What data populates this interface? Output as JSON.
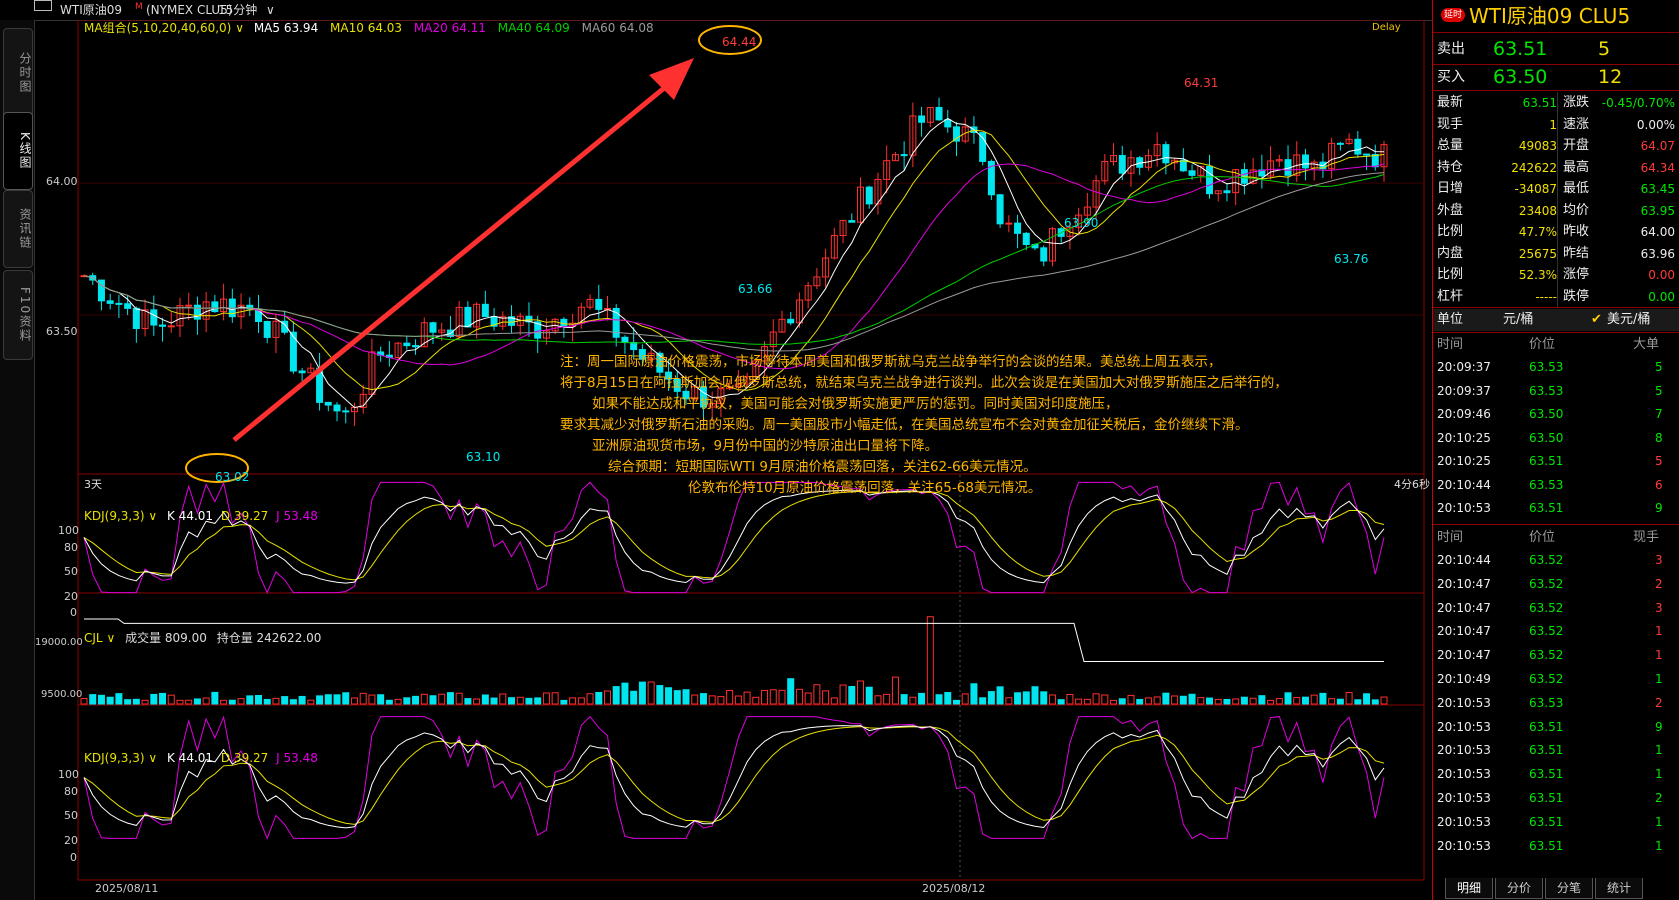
{
  "topbar": {
    "icon": "window-icon",
    "symbol": "WTI原油09",
    "symbol_mark": "M",
    "exchange": "(NYMEX CLU5)",
    "period": "15分钟",
    "period_arrow": "∨"
  },
  "left_tabs": [
    "分时图",
    "K线图",
    "资讯链",
    "F10资料"
  ],
  "chart_data": [
    {
      "type": "candlestick",
      "indicator_label": "MA组合(5,10,20,40,60,0)",
      "ma_items": [
        {
          "label": "MA5",
          "value": "63.94",
          "color": "#ffffff"
        },
        {
          "label": "MA10",
          "value": "64.03",
          "color": "#e8e000"
        },
        {
          "label": "MA20",
          "value": "64.11",
          "color": "#e000e0"
        },
        {
          "label": "MA40",
          "value": "64.09",
          "color": "#00d000"
        },
        {
          "label": "MA60",
          "value": "64.08",
          "color": "#9a9a9a"
        }
      ],
      "delay_tag": "Delay",
      "y_ticks": [
        "64.00",
        "63.50"
      ],
      "price_annotations": [
        "64.44",
        "64.31",
        "63.90",
        "63.76",
        "63.66",
        "63.10",
        "63.02"
      ],
      "bottom_left": "3天",
      "bottom_right": "4分6秒",
      "ylim": [
        62.95,
        64.55
      ]
    },
    {
      "type": "line",
      "indicator_label": "KDJ(9,3,3)",
      "values_text": {
        "K": "K 44.01",
        "D": "D 39.27",
        "J": "J 53.48"
      },
      "y_ticks": [
        "100",
        "80",
        "50",
        "20",
        "0"
      ]
    },
    {
      "type": "bar",
      "indicator_label": "CJL",
      "volume_text": "成交量 809.00",
      "oi_text": "持仓量 242622.00",
      "y_ticks": [
        "19000.00",
        "9500.00"
      ]
    },
    {
      "type": "line",
      "indicator_label": "KDJ(9,3,3)",
      "values_text": {
        "K": "K 44.01",
        "D": "D 39.27",
        "J": "J 53.48"
      },
      "y_ticks": [
        "100",
        "80",
        "50",
        "20",
        "0"
      ]
    }
  ],
  "x_dates": [
    "2025/08/11",
    "2025/08/12"
  ],
  "annotation": {
    "lines": [
      "注：周一国际原油价格震荡，市场等待本周美国和俄罗斯就乌克兰战争举行的会谈的结果。美总统上周五表示，",
      "将于8月15日在阿拉斯加会见俄罗斯总统，就结束乌克兰战争进行谈判。此次会谈是在美国加大对俄罗斯施压之后举行的，",
      "如果不能达成和平协议，美国可能会对俄罗斯实施更严厉的惩罚。同时美国对印度施压，",
      "要求其减少对俄罗斯石油的采购。周一美国股市小幅走低，在美国总统宣布不会对黄金加征关税后，金价继续下滑。",
      "亚洲原油现货市场，9月份中国的沙特原油出口量将下降。",
      "综合预期：短期国际WTI 9月原油价格震荡回落，关注62-66美元情况。",
      "伦敦布伦特10月原油价格震荡回落，关注65-68美元情况。"
    ]
  },
  "quote": {
    "badge": "延时",
    "title": "WTI原油09 CLU5",
    "sell": {
      "label": "卖出",
      "price": "63.51",
      "qty": "5"
    },
    "buy": {
      "label": "买入",
      "price": "63.50",
      "qty": "12"
    },
    "stats": [
      {
        "l1": "最新",
        "v1": "63.51",
        "c1": "green",
        "l2": "涨跌",
        "v2": "-0.45/0.70%",
        "c2": "green"
      },
      {
        "l1": "现手",
        "v1": "1",
        "c1": "yellow",
        "l2": "速涨",
        "v2": "0.00%",
        "c2": "white"
      },
      {
        "l1": "总量",
        "v1": "49083",
        "c1": "yellow",
        "l2": "开盘",
        "v2": "64.07",
        "c2": "red"
      },
      {
        "l1": "持仓",
        "v1": "242622",
        "c1": "yellow",
        "l2": "最高",
        "v2": "64.34",
        "c2": "red"
      },
      {
        "l1": "日增",
        "v1": "-34087",
        "c1": "yellow",
        "l2": "最低",
        "v2": "63.45",
        "c2": "green"
      },
      {
        "l1": "外盘",
        "v1": "23408",
        "c1": "yellow",
        "l2": "均价",
        "v2": "63.95",
        "c2": "green"
      },
      {
        "l1": "比例",
        "v1": "47.7%",
        "c1": "yellow",
        "l2": "昨收",
        "v2": "64.00",
        "c2": "white"
      },
      {
        "l1": "内盘",
        "v1": "25675",
        "c1": "yellow",
        "l2": "昨结",
        "v2": "63.96",
        "c2": "white"
      },
      {
        "l1": "比例",
        "v1": "52.3%",
        "c1": "yellow",
        "l2": "涨停",
        "v2": "0.00",
        "c2": "red"
      },
      {
        "l1": "杠杆",
        "v1": "-----",
        "c1": "yellow",
        "l2": "跌停",
        "v2": "0.00",
        "c2": "green"
      }
    ],
    "unit": {
      "label": "单位",
      "opt1": "元/桶",
      "opt2": "美元/桶",
      "check": "✔"
    },
    "ticks_header": {
      "time": "时间",
      "price": "价位",
      "vol": "大单"
    },
    "ticks": [
      {
        "time": "20:09:37",
        "price": "63.53",
        "vol": "5",
        "vc": "green"
      },
      {
        "time": "20:09:37",
        "price": "63.53",
        "vol": "5",
        "vc": "green"
      },
      {
        "time": "20:09:46",
        "price": "63.50",
        "vol": "7",
        "vc": "green"
      },
      {
        "time": "20:10:25",
        "price": "63.50",
        "vol": "8",
        "vc": "green"
      },
      {
        "time": "20:10:25",
        "price": "63.51",
        "vol": "5",
        "vc": "red"
      },
      {
        "time": "20:10:44",
        "price": "63.53",
        "vol": "6",
        "vc": "red"
      },
      {
        "time": "20:10:53",
        "price": "63.51",
        "vol": "9",
        "vc": "green"
      }
    ],
    "trades_header": {
      "time": "时间",
      "price": "价位",
      "vol": "现手"
    },
    "trades": [
      {
        "time": "20:10:44",
        "price": "63.52",
        "vol": "3",
        "vc": "red"
      },
      {
        "time": "20:10:47",
        "price": "63.52",
        "vol": "2",
        "vc": "red"
      },
      {
        "time": "20:10:47",
        "price": "63.52",
        "vol": "3",
        "vc": "red"
      },
      {
        "time": "20:10:47",
        "price": "63.52",
        "vol": "1",
        "vc": "red"
      },
      {
        "time": "20:10:47",
        "price": "63.52",
        "vol": "1",
        "vc": "red"
      },
      {
        "time": "20:10:49",
        "price": "63.52",
        "vol": "1",
        "vc": "green"
      },
      {
        "time": "20:10:53",
        "price": "63.53",
        "vol": "2",
        "vc": "red"
      },
      {
        "time": "20:10:53",
        "price": "63.51",
        "vol": "9",
        "vc": "green"
      },
      {
        "time": "20:10:53",
        "price": "63.51",
        "vol": "1",
        "vc": "green"
      },
      {
        "time": "20:10:53",
        "price": "63.51",
        "vol": "1",
        "vc": "green"
      },
      {
        "time": "20:10:53",
        "price": "63.51",
        "vol": "2",
        "vc": "green"
      },
      {
        "time": "20:10:53",
        "price": "63.51",
        "vol": "1",
        "vc": "green"
      },
      {
        "time": "20:10:53",
        "price": "63.51",
        "vol": "1",
        "vc": "green"
      }
    ],
    "bottom_tabs": [
      "明细",
      "分价",
      "分笔",
      "统计"
    ]
  },
  "colors": {
    "up": "#ff3030",
    "down": "#00e5ee",
    "accent": "#ffb400"
  }
}
